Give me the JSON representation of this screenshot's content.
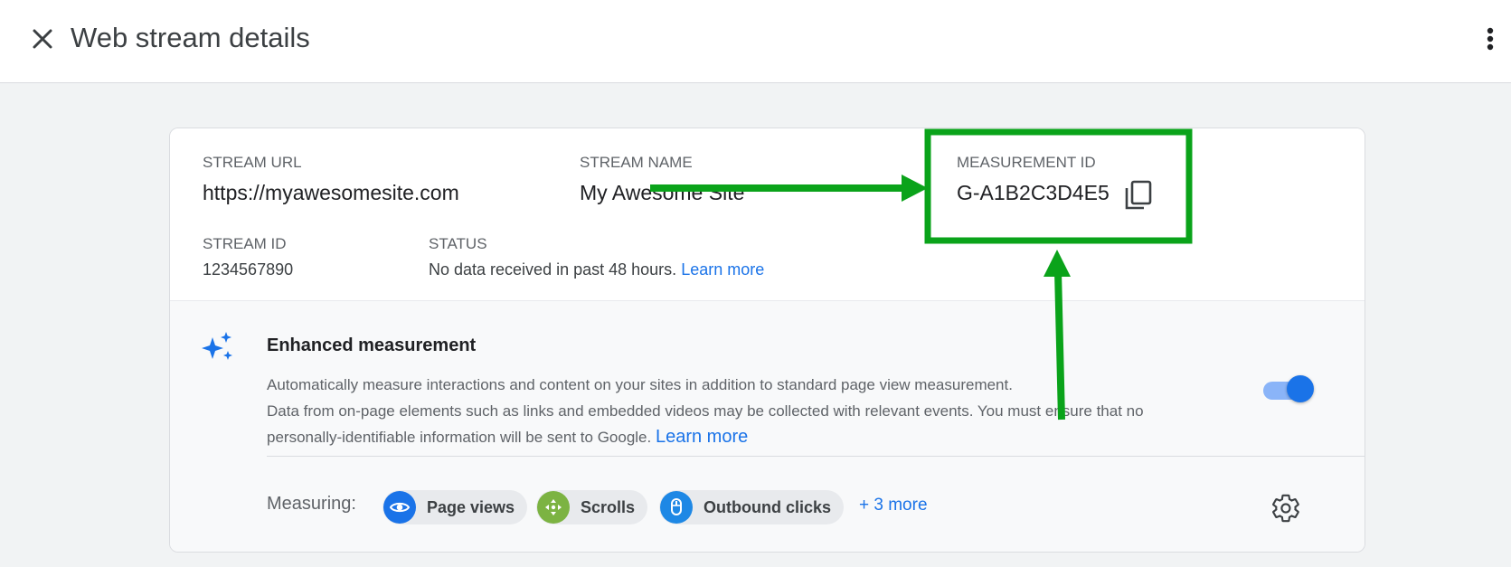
{
  "header": {
    "title": "Web stream details"
  },
  "stream": {
    "url_label": "STREAM URL",
    "url": "https://myawesomesite.com",
    "name_label": "STREAM NAME",
    "name": "My Awesome Site",
    "measurement_label": "MEASUREMENT ID",
    "measurement_id": "G-A1B2C3D4E5",
    "id_label": "STREAM ID",
    "id": "1234567890",
    "status_label": "STATUS",
    "status_text": "No data received in past 48 hours.",
    "status_link": "Learn more"
  },
  "enhanced": {
    "title": "Enhanced measurement",
    "desc_line1": "Automatically measure interactions and content on your sites in addition to standard page view measurement.",
    "desc_line2": "Data from on-page elements such as links and embedded videos may be collected with relevant events. You must ensure that no",
    "desc_line3": "personally-identifiable information will be sent to Google.",
    "learn_more": "Learn more",
    "toggle_on": true,
    "measuring_label": "Measuring:",
    "chips": [
      {
        "label": "Page views",
        "icon": "eye-icon",
        "color": "#1a73e8"
      },
      {
        "label": "Scrolls",
        "icon": "scroll-icon",
        "color": "#7cb342"
      },
      {
        "label": "Outbound clicks",
        "icon": "mouse-icon",
        "color": "#1e88e5"
      }
    ],
    "more": "+ 3 more"
  },
  "colors": {
    "accent": "#1a73e8",
    "annotation": "#0aa31a"
  }
}
